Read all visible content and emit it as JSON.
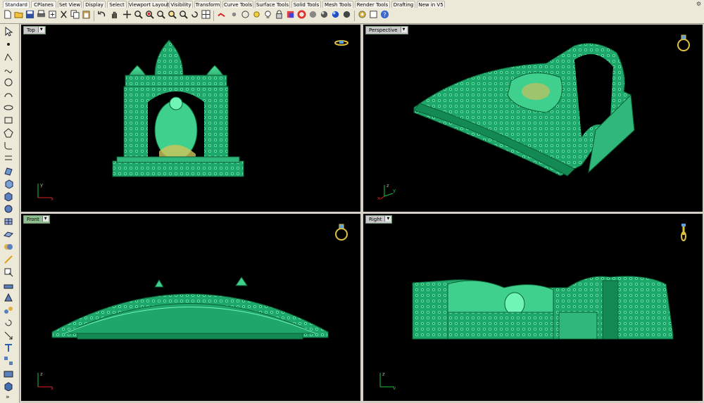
{
  "tabs": [
    "Standard",
    "CPlanes",
    "Set View",
    "Display",
    "Select",
    "Viewport Layout",
    "Visibility",
    "Transform",
    "Curve Tools",
    "Surface Tools",
    "Solid Tools",
    "Mesh Tools",
    "Render Tools",
    "Drafting",
    "New in V5"
  ],
  "viewports": {
    "top": {
      "label": "Top"
    },
    "perspective": {
      "label": "Perspective"
    },
    "front": {
      "label": "Front"
    },
    "right": {
      "label": "Right"
    }
  },
  "axis_labels": {
    "x": "x",
    "y": "y",
    "z": "z"
  },
  "colors": {
    "model": "#1fa66a",
    "model_light": "#4fe09a",
    "gold": "#e0c040",
    "background": "#000000",
    "active_label": "#8fbc8f"
  }
}
